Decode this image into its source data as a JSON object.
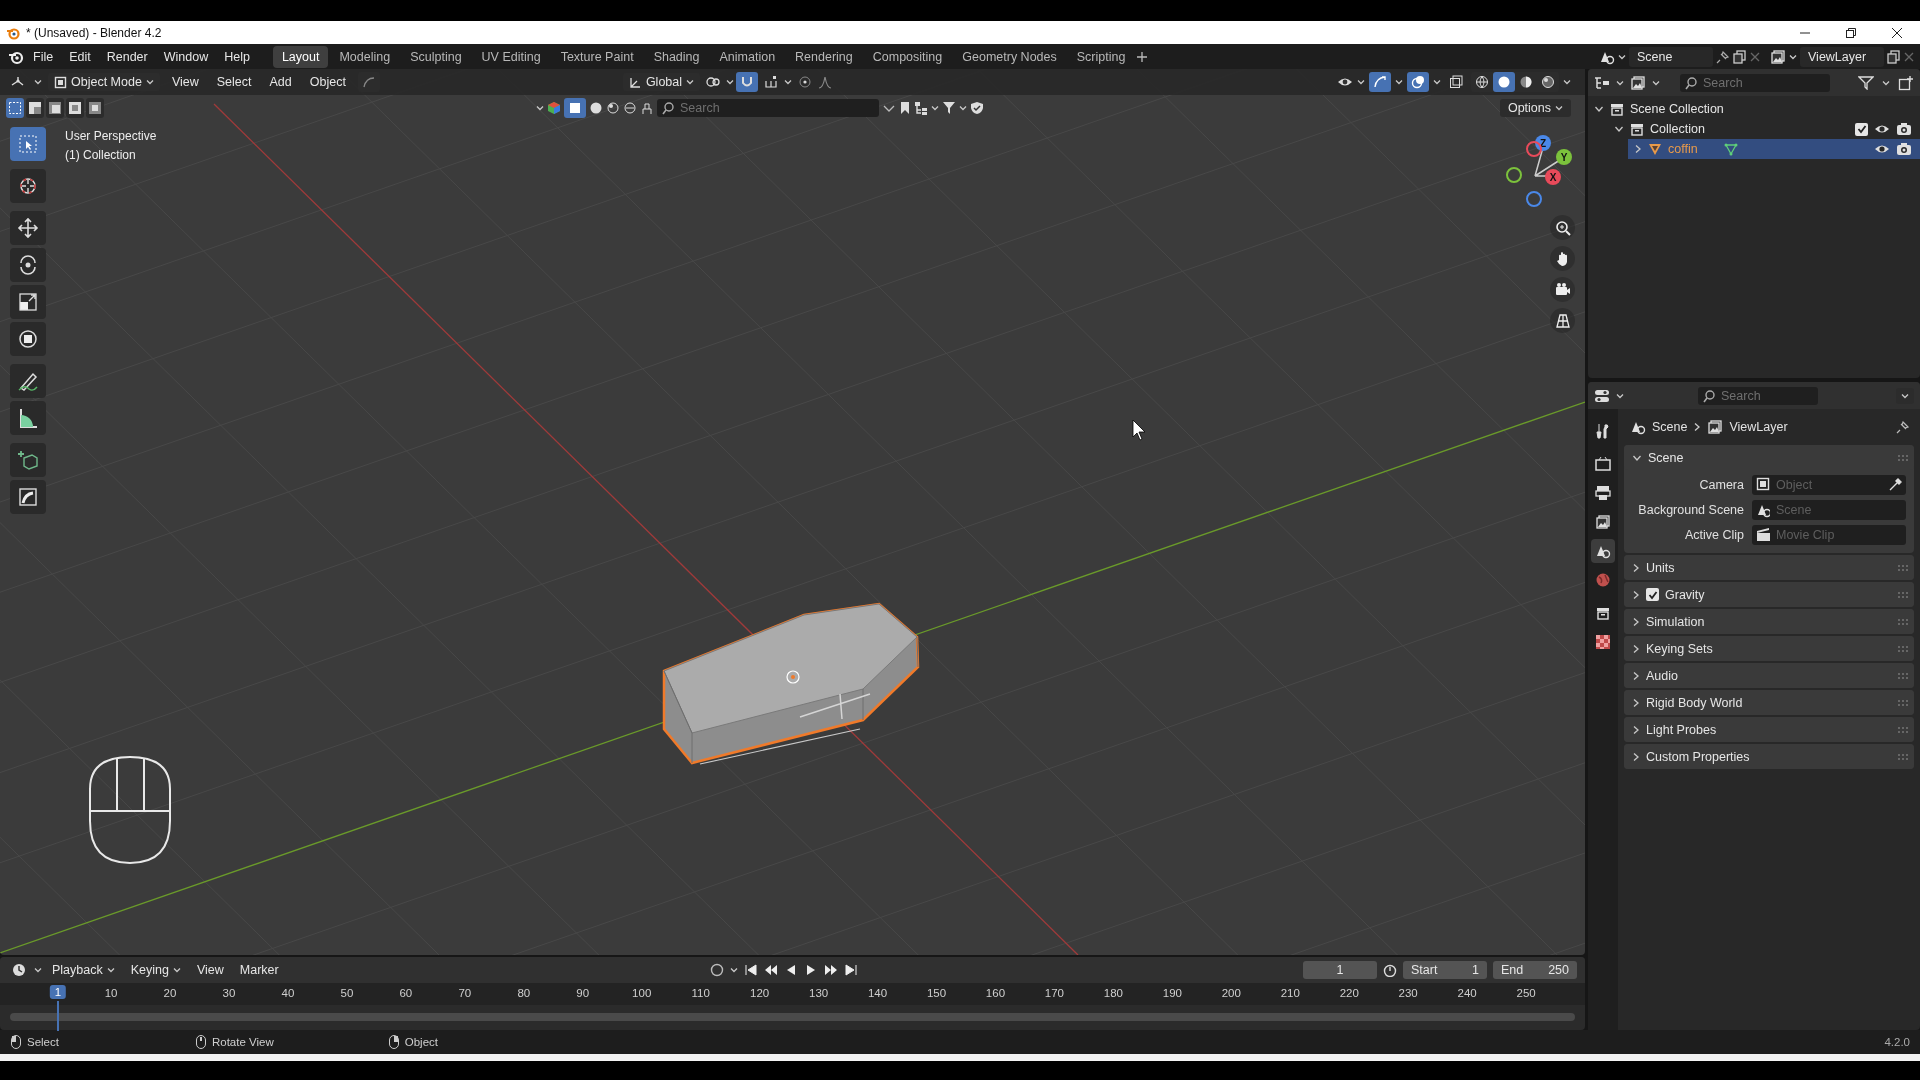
{
  "window": {
    "title": "* (Unsaved) - Blender 4.2"
  },
  "menu_bar": {
    "menus": [
      "File",
      "Edit",
      "Render",
      "Window",
      "Help"
    ]
  },
  "workspace_tabs": [
    {
      "label": "Layout",
      "selected": true
    },
    {
      "label": "Modeling",
      "selected": false
    },
    {
      "label": "Sculpting",
      "selected": false
    },
    {
      "label": "UV Editing",
      "selected": false
    },
    {
      "label": "Texture Paint",
      "selected": false
    },
    {
      "label": "Shading",
      "selected": false
    },
    {
      "label": "Animation",
      "selected": false
    },
    {
      "label": "Rendering",
      "selected": false
    },
    {
      "label": "Compositing",
      "selected": false
    },
    {
      "label": "Geometry Nodes",
      "selected": false
    },
    {
      "label": "Scripting",
      "selected": false
    }
  ],
  "scene_selector": {
    "scene": "Scene",
    "view_layer": "ViewLayer"
  },
  "viewport_header": {
    "mode": "Object Mode",
    "menus": [
      "View",
      "Select",
      "Add",
      "Object"
    ],
    "transform_orientation": "Global",
    "snap_on": true,
    "shading_modes": [
      {
        "selected": false
      },
      {
        "selected": true
      },
      {
        "selected": false
      },
      {
        "selected": false
      }
    ],
    "select_modes": [
      {
        "selected": true
      },
      {
        "selected": false
      },
      {
        "selected": false
      },
      {
        "selected": false
      },
      {
        "selected": false
      }
    ],
    "search_placeholder": "Search",
    "options": "Options"
  },
  "viewport": {
    "overlay_lines": [
      "User Perspective",
      "(1) Collection"
    ],
    "tools": [
      {
        "selected": true
      },
      {
        "selected": false
      },
      {
        "selected": false
      },
      {
        "selected": false
      },
      {
        "selected": false
      },
      {
        "selected": false
      },
      {
        "selected": false
      },
      {
        "selected": false
      },
      {
        "selected": false
      },
      {
        "selected": false
      }
    ],
    "gizmo_axes": [
      "Z",
      "Y",
      "X"
    ]
  },
  "outliner": {
    "search_placeholder": "Search",
    "tree": [
      {
        "label": "Scene Collection",
        "kind": "scene_collection",
        "expanded": true,
        "selected": false,
        "children": [
          {
            "label": "Collection",
            "kind": "collection",
            "expanded": true,
            "selected": false,
            "children": [
              {
                "label": "coffin",
                "kind": "object",
                "expanded": false,
                "selected": true
              }
            ]
          }
        ]
      }
    ]
  },
  "properties": {
    "search_placeholder": "Search",
    "breadcrumb": [
      "Scene",
      "ViewLayer"
    ],
    "tabs": [
      {
        "selected": false
      },
      {
        "selected": false
      },
      {
        "selected": false
      },
      {
        "selected": false
      },
      {
        "selected": true
      },
      {
        "selected": false
      },
      {
        "selected": false
      },
      {
        "selected": false
      }
    ],
    "panels": [
      {
        "title": "Scene",
        "kind": "plain",
        "expanded": true,
        "fields": [
          {
            "label": "Camera",
            "placeholder": "Object"
          },
          {
            "label": "Background Scene",
            "placeholder": "Scene"
          },
          {
            "label": "Active Clip",
            "placeholder": "Movie Clip"
          }
        ]
      },
      {
        "title": "Units",
        "kind": "plain",
        "expanded": false
      },
      {
        "title": "Gravity",
        "kind": "toggle",
        "expanded": false,
        "checked": true
      },
      {
        "title": "Simulation",
        "kind": "plain",
        "expanded": false
      },
      {
        "title": "Keying Sets",
        "kind": "plain",
        "expanded": false
      },
      {
        "title": "Audio",
        "kind": "plain",
        "expanded": false
      },
      {
        "title": "Rigid Body World",
        "kind": "plain",
        "expanded": false
      },
      {
        "title": "Light Probes",
        "kind": "plain",
        "expanded": false
      },
      {
        "title": "Custom Properties",
        "kind": "plain",
        "expanded": false
      }
    ]
  },
  "timeline": {
    "menus": [
      "Playback",
      "Keying",
      "View",
      "Marker"
    ],
    "current_frame": "1",
    "start_label": "Start",
    "start": "1",
    "end_label": "End",
    "end": "250",
    "ruler_labels": [
      "10",
      "20",
      "30",
      "40",
      "50",
      "60",
      "70",
      "80",
      "90",
      "100",
      "110",
      "120",
      "130",
      "140",
      "150",
      "160",
      "170",
      "180",
      "190",
      "200",
      "210",
      "220",
      "230",
      "240",
      "250"
    ],
    "playhead": "1"
  },
  "status_bar": {
    "hints": [
      "Select",
      "Rotate View",
      "Object"
    ],
    "version": "4.2.0"
  }
}
